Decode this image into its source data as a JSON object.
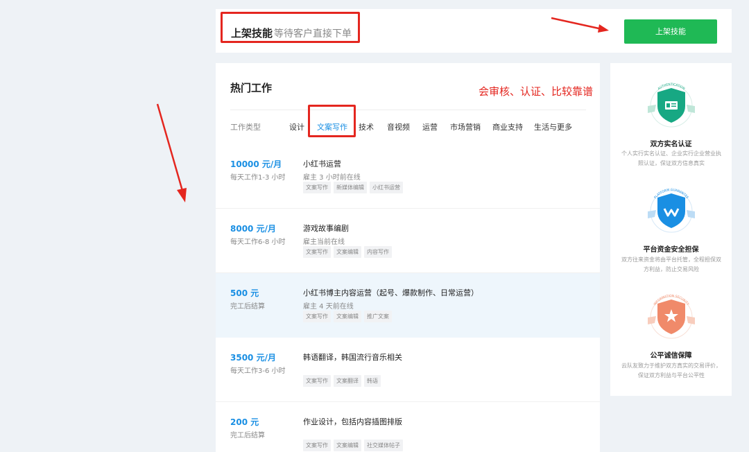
{
  "banner": {
    "title": "上架技能",
    "subtitle": "等待客户直接下单",
    "button_label": "上架技能"
  },
  "hot_jobs": {
    "title": "热门工作",
    "annotation": "会审核、认证、比较靠谱",
    "filter_label": "工作类型",
    "categories": [
      "设计",
      "文案写作",
      "技术",
      "音视频",
      "运营",
      "市场营销",
      "商业支持",
      "生活与更多"
    ],
    "active_category": "文案写作",
    "jobs": [
      {
        "salary": "10000 元/月",
        "schedule": "每天工作1-3 小时",
        "title": "小红书运营",
        "meta": "雇主 3 小时前在线",
        "tags": [
          "文案写作",
          "新媒体编辑",
          "小红书运营"
        ]
      },
      {
        "salary": "8000 元/月",
        "schedule": "每天工作6-8 小时",
        "title": "游戏故事编剧",
        "meta": "雇主当前在线",
        "tags": [
          "文案写作",
          "文案编辑",
          "内容写作"
        ]
      },
      {
        "salary": "500 元",
        "schedule": "完工后结算",
        "title": "小红书博主内容运营（起号、爆款制作、日常运营）",
        "meta": "雇主 4 天前在线",
        "tags": [
          "文案写作",
          "文案编辑",
          "推广文案"
        ]
      },
      {
        "salary": "3500 元/月",
        "schedule": "每天工作3-6 小时",
        "title": "韩语翻译，韩国流行音乐相关",
        "meta": "",
        "tags": [
          "文案写作",
          "文案翻译",
          "韩语"
        ]
      },
      {
        "salary": "200 元",
        "schedule": "完工后结算",
        "title": "作业设计，包括内容插图排版",
        "meta": "",
        "tags": [
          "文案写作",
          "文案编辑",
          "社交媒体帖子"
        ]
      }
    ]
  },
  "guarantees": [
    {
      "badge_text": "AUTHENTICATION",
      "icon": "id-card-icon",
      "color": "#17a883",
      "title": "双方实名认证",
      "desc": "个人实行实名认证、企业实行企业营业执照认证，保证双方信息真实"
    },
    {
      "badge_text": "PLATFORM GUARANTEE",
      "icon": "shield-check-icon",
      "color": "#1a8fe3",
      "title": "平台资金安全担保",
      "desc": "双方往来资金将由平台托管，全程担保双方利益，防止交易风险"
    },
    {
      "badge_text": "INFORMATION SECURITY",
      "icon": "star-shield-icon",
      "color": "#f08a6a",
      "title": "公平诚信保障",
      "desc": "云队友致力于维护双方真实的交易评价，保证双方利益与平台公平性"
    }
  ],
  "colors": {
    "accent": "#1a8fe3",
    "button": "#1fb955",
    "annotation": "#e4261f"
  }
}
